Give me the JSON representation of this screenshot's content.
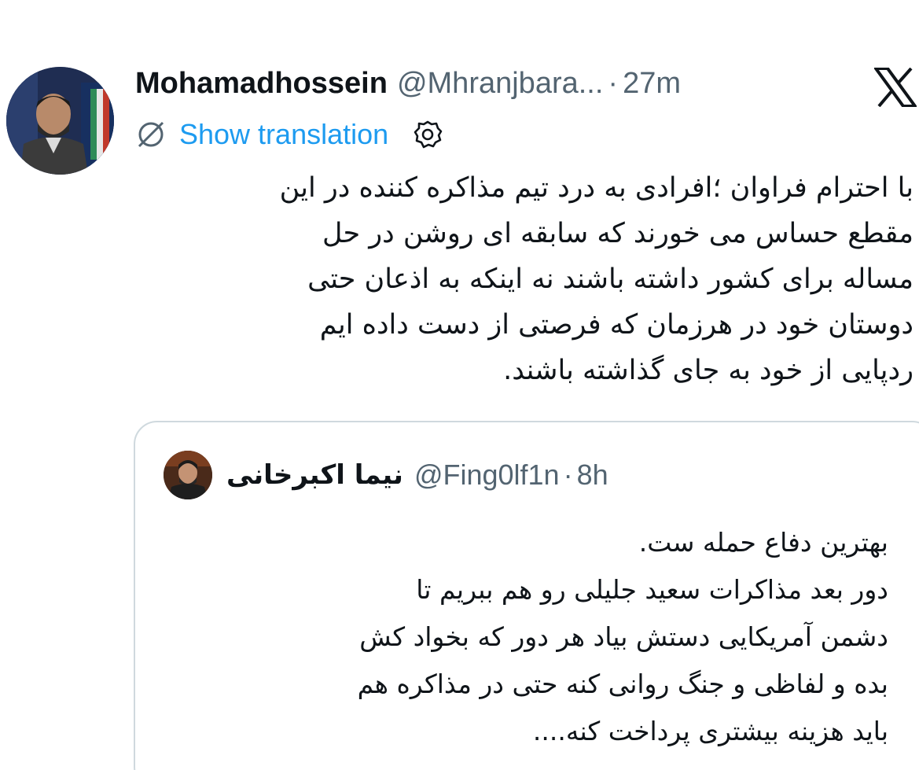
{
  "author": {
    "display_name": "Mohamadhossein",
    "handle": "@Mhranjbara...",
    "separator": "·",
    "time": "27m",
    "avatar": "author-avatar"
  },
  "platform": {
    "logo_icon": "x-logo-icon"
  },
  "translation": {
    "icon": "globe-slash-icon",
    "label": "Show translation",
    "settings_icon": "gear-icon"
  },
  "tweet": {
    "text": "با احترام فراوان ؛افرادی به درد تیم مذاکره کننده در این\nمقطع حساس می خورند که سابقه ای روشن در حل\nمساله برای کشور داشته باشند نه اینکه به اذعان حتی\nدوستان خود در هرزمان که فرصتی از دست داده ایم\nردپایی از خود به جای گذاشته باشند."
  },
  "quoted_tweet": {
    "display_name": "نیما اکبرخانی",
    "handle": "@Fing0lf1n",
    "separator": "·",
    "time": "8h",
    "text": "بهترین دفاع حمله ست.\nدور بعد مذاکرات سعید جلیلی رو هم ببریم تا\nدشمن آمریکایی دستش بیاد هر دور که بخواد کش\nبده و لفاظی و جنگ روانی کنه حتی در مذاکره هم\nباید هزینه بیشتری پرداخت کنه...."
  },
  "colors": {
    "text_primary": "#0f1419",
    "text_secondary": "#536471",
    "link": "#1d9bf0",
    "border": "#cfd9de"
  }
}
